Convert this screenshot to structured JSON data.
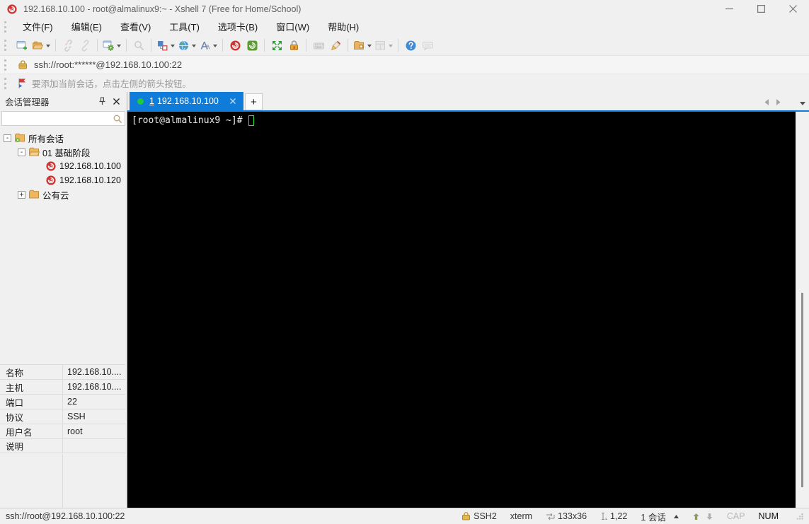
{
  "window": {
    "title": "192.168.10.100 - root@almalinux9:~ - Xshell 7 (Free for Home/School)"
  },
  "menu": {
    "items": [
      {
        "label": "文件(F)"
      },
      {
        "label": "编辑(E)"
      },
      {
        "label": "查看(V)"
      },
      {
        "label": "工具(T)"
      },
      {
        "label": "选项卡(B)"
      },
      {
        "label": "窗口(W)"
      },
      {
        "label": "帮助(H)"
      }
    ]
  },
  "toolbar": {
    "icons": [
      "new-session-icon",
      "open-folder-icon",
      "disconnect-icon",
      "reconnect-icon",
      "session-properties-icon",
      "find-icon",
      "color-scheme-icon",
      "globe-icon",
      "font-icon",
      "xshell-icon",
      "xftp-icon",
      "fullscreen-icon",
      "lock-icon",
      "keyboard-icon",
      "highlight-icon",
      "new-folder-icon",
      "tile-layout-icon",
      "help-icon",
      "chat-icon"
    ]
  },
  "address_bar": {
    "url": "ssh://root:******@192.168.10.100:22"
  },
  "hint_bar": {
    "text": "要添加当前会话，点击左侧的箭头按钮。"
  },
  "session_manager": {
    "title": "会话管理器",
    "search_value": "",
    "tree": [
      {
        "label": "所有会话",
        "icon": "all-sessions-folder",
        "expander": "-"
      },
      {
        "label": "01 基础阶段",
        "icon": "folder",
        "expander": "-"
      },
      {
        "label": "192.168.10.100",
        "icon": "session"
      },
      {
        "label": "192.168.10.120",
        "icon": "session"
      },
      {
        "label": "公有云",
        "icon": "folder",
        "expander": "+"
      }
    ],
    "properties": {
      "rows": [
        {
          "label": "名称",
          "value": "192.168.10...."
        },
        {
          "label": "主机",
          "value": "192.168.10...."
        },
        {
          "label": "端口",
          "value": "22"
        },
        {
          "label": "协议",
          "value": "SSH"
        },
        {
          "label": "用户名",
          "value": "root"
        },
        {
          "label": "说明",
          "value": ""
        }
      ]
    }
  },
  "tabs": {
    "active_index": "1",
    "active_label": "192.168.10.100",
    "new_tab_label": "+"
  },
  "terminal": {
    "prompt": "[root@almalinux9 ~]# "
  },
  "status_bar": {
    "connection": "ssh://root@192.168.10.100:22",
    "protocol": "SSH2",
    "terminal_type": "xterm",
    "size": "133x36",
    "cursor_position": "1,22",
    "session_count": "1 会话",
    "caps_indicator": "CAP",
    "num_indicator": "NUM"
  },
  "colors": {
    "tab_active_bg": "#0f7cd9",
    "terminal_bg": "#000000",
    "terminal_fg": "#ececec",
    "cursor_green": "#2ee22e",
    "tab_status_dot": "#1ec93e",
    "chrome_bg": "#f0f0f0",
    "xshell_red": "#cf3434",
    "xftp_green": "#5a9e32"
  }
}
